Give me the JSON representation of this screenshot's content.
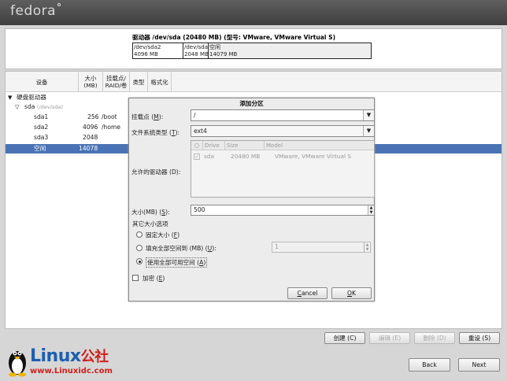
{
  "brand": {
    "logo_text": "fedora"
  },
  "drive": {
    "title": "驱动器 /dev/sda (20480 MB) (型号: VMware, VMware Virtual S)",
    "segments": [
      {
        "name": "/dev/sda2",
        "size": "4096 MB"
      },
      {
        "name": "/dev/sda",
        "size": "2048 MB"
      },
      {
        "name": "空闲",
        "size": "14079 MB"
      }
    ]
  },
  "table": {
    "headers": [
      "设备",
      "大小\n(MB)",
      "挂载点/\nRAID/卷",
      "类型",
      "格式化"
    ],
    "rows": [
      {
        "device": "硬盘驱动器",
        "level": 0,
        "expander": "▼"
      },
      {
        "device": "sda",
        "sub": "(/dev/sda)",
        "level": 1,
        "expander": "▽"
      },
      {
        "device": "sda1",
        "size": "256",
        "mount": "/boot",
        "level": 2
      },
      {
        "device": "sda2",
        "size": "4096",
        "mount": "/home",
        "level": 2
      },
      {
        "device": "sda3",
        "size": "2048",
        "mount": "",
        "level": 2
      },
      {
        "device": "空闲",
        "size": "14078",
        "mount": "",
        "level": 2,
        "selected": true
      }
    ]
  },
  "dialog": {
    "title": "添加分区",
    "mount_label": "挂载点 (",
    "mount_key": "M",
    "mount_label_end": "):",
    "mount_value": "/",
    "fs_label": "文件系统类型 (",
    "fs_key": "T",
    "fs_label_end": "):",
    "fs_value": "ext4",
    "drives_label": "允许的驱动器 (D):",
    "drive_cols": [
      "Drive",
      "Size",
      "Model"
    ],
    "drive_row": {
      "drive": "sda",
      "size": "20480 MB",
      "model": "VMware, VMware Virtual S"
    },
    "size_label": "大小(MB) (",
    "size_key": "S",
    "size_label_end": "):",
    "size_value": "500",
    "other_title": "其它大小选项",
    "opt_fixed": "固定大小 (",
    "opt_fixed_key": "F",
    "opt_fixed_end": ")",
    "opt_fill_to": "填充全部空间到 (MB) (",
    "opt_fill_to_key": "U",
    "opt_fill_to_end": "):",
    "fill_to_value": "1",
    "opt_fill_all": "使用全部可用空间 (",
    "opt_fill_all_key": "A",
    "opt_fill_all_end": ")",
    "encrypt_label": "加密 (",
    "encrypt_key": "E",
    "encrypt_end": ")",
    "cancel_key": "C",
    "cancel_rest": "ancel",
    "ok_key": "O",
    "ok_rest": "K"
  },
  "actions": {
    "create": "创建 (C)",
    "edit": "编辑 (E)",
    "delete": "删除 (D)",
    "reset": "重设 (S)"
  },
  "nav": {
    "back": "Back",
    "next": "Next"
  },
  "watermark": {
    "name": "Linux",
    "suffix": "公社",
    "url": "www.Linuxidc.com"
  }
}
